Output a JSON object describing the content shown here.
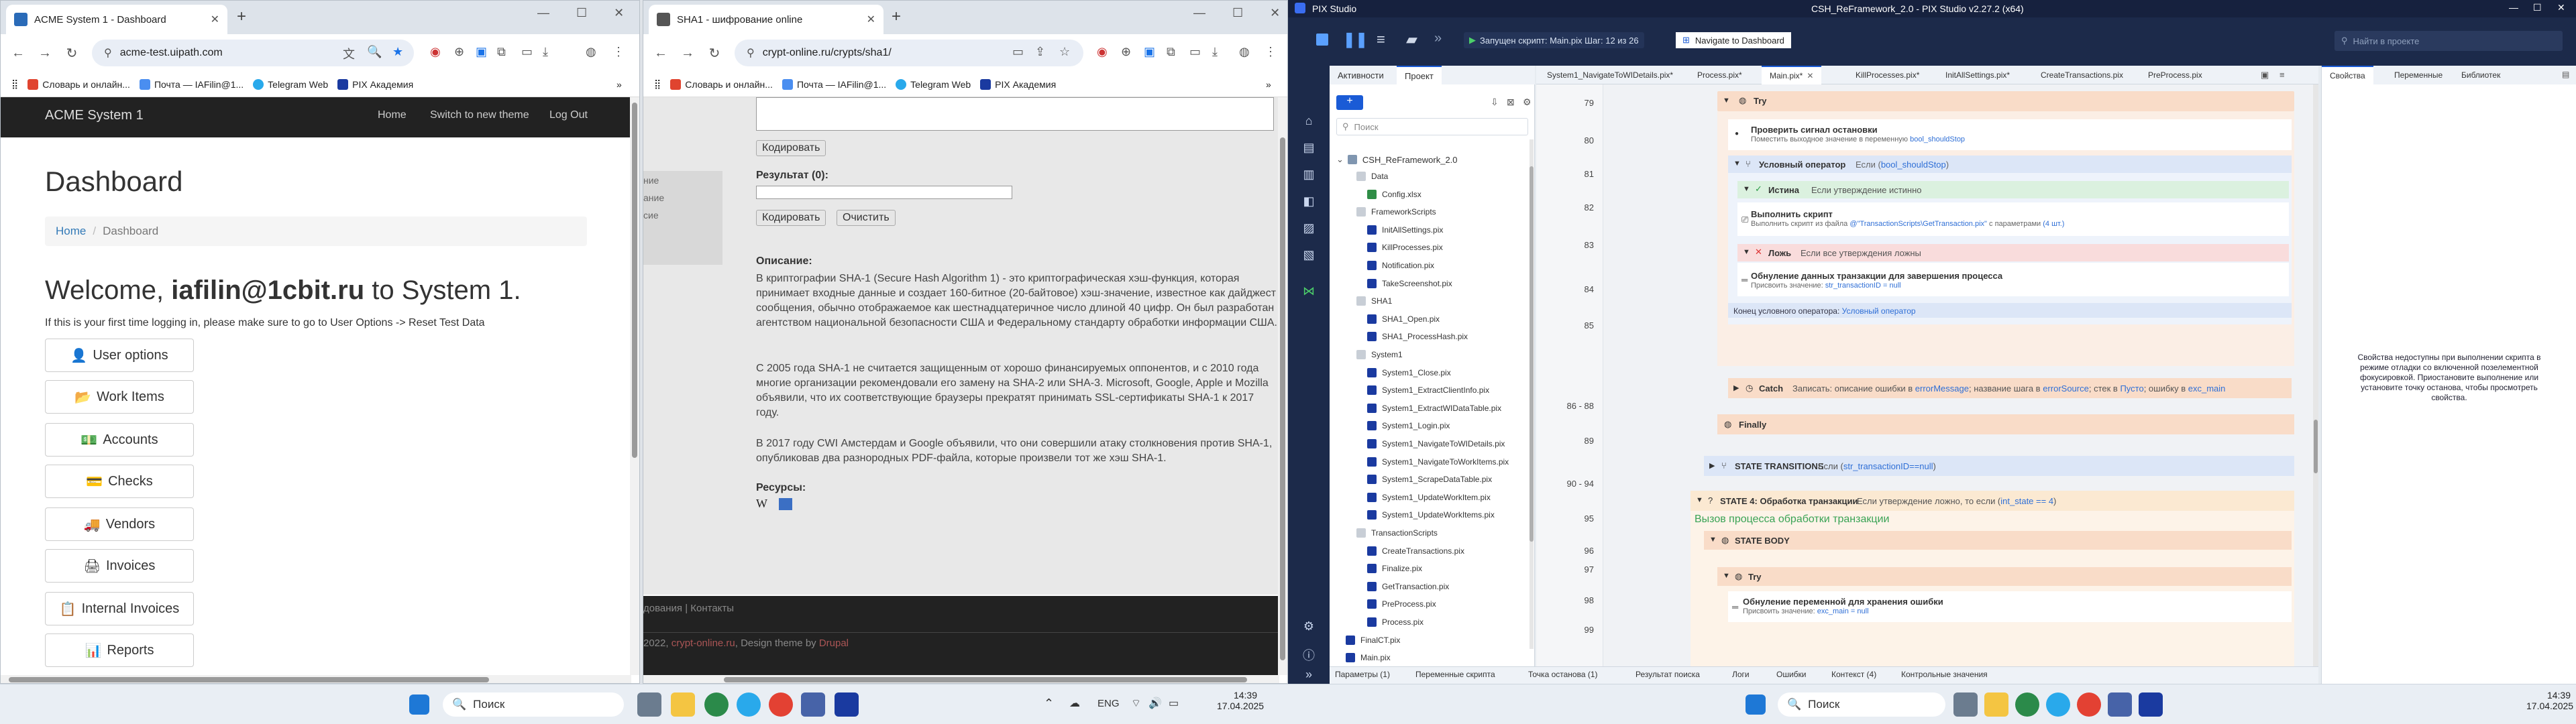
{
  "acme_browser": {
    "tab_title": "ACME System 1 - Dashboard",
    "url": "acme-test.uipath.com",
    "bookmarks": [
      "Словарь и онлайн...",
      "Почта — IAFilin@1...",
      "Telegram Web",
      "PIX Академия"
    ],
    "brand": "ACME System 1",
    "nav": [
      "Home",
      "Switch to new theme",
      "Log Out"
    ],
    "heading": "Dashboard",
    "breadcrumb": {
      "home": "Home",
      "sep": "/",
      "current": "Dashboard"
    },
    "welcome_pre": "Welcome, ",
    "welcome_user": "iafilin@1cbit.ru",
    "welcome_post": " to System 1.",
    "first_time_note": "If this is your first time logging in, please make sure to go to User Options -> Reset Test Data",
    "menu": [
      {
        "icon": "👤",
        "label": "User options"
      },
      {
        "icon": "📂",
        "label": "Work Items"
      },
      {
        "icon": "💵",
        "label": "Accounts"
      },
      {
        "icon": "💳",
        "label": "Checks"
      },
      {
        "icon": "🚚",
        "label": "Vendors"
      },
      {
        "icon": "🖨",
        "label": "Invoices"
      },
      {
        "icon": "📋",
        "label": "Internal Invoices"
      },
      {
        "icon": "📊",
        "label": "Reports"
      }
    ]
  },
  "crypt_browser": {
    "tab_title": "SHA1 - шифрование online",
    "url": "crypt-online.ru/crypts/sha1/",
    "bookmarks": [
      "Словарь и онлайн...",
      "Почта — IAFilin@1...",
      "Telegram Web",
      "PIX Академия"
    ],
    "encode_btn": "Кодировать",
    "result_label": "Результат (0):",
    "encode_btn2": "Кодировать",
    "clear_btn": "Очистить",
    "side_items": [
      "ние",
      "ание",
      "сие"
    ],
    "description_title": "Описание:",
    "p1": "В криптографии SHA-1 (Secure Hash Algorithm 1) - это криптографическая хэш-функция, которая принимает входные данные и создает 160-битное (20-байтовое) хэш-значение, известное как дайджест сообщения, обычно отображаемое как шестнадцатеричное число длиной 40 цифр. Он был разработан агентством национальной безопасности США и Федеральному стандарту обработки информации США.",
    "p2": "С 2005 года SHA-1 не считается защищенным от хорошо финансируемых оппонентов, и с 2010 года многие организации рекомендовали его замену на SHA-2 или SHA-3. Microsoft, Google, Apple и Mozilla объявили, что их соответствующие браузеры прекратят принимать SSL-сертификаты SHA-1 к 2017 году.",
    "p3": "В 2017 году CWI Амстердам и Google объявили, что они совершили атаку столкновения против SHA-1, опубликовав два разнородных PDF-файла, которые произвели тот же хэш SHA-1.",
    "resources": "Ресурсы:",
    "footer1_a": "дования",
    "footer1_sep": " | ",
    "footer1_b": "Контакты",
    "footer2_pre": "2022, ",
    "footer2_link": "crypt-online.ru",
    "footer2_mid": ", Design theme by ",
    "footer2_theme": "Drupal"
  },
  "pix": {
    "window_title": "CSH_ReFramework_2.0 - PIX Studio v2.27.2 (x64)",
    "app_name": "PIX Studio",
    "status": "Запущен скрипт: Main.pix  Шаг: 12 из 26",
    "nav_action": "Navigate to Dashboard",
    "search_project": "Найти в проекте",
    "search_tree": "Поиск",
    "panel_tabs": [
      "Активности",
      "Проект"
    ],
    "project_root": "CSH_ReFramework_2.0",
    "tree": [
      {
        "label": "Data",
        "lvl": 1,
        "type": "folder"
      },
      {
        "label": "Config.xlsx",
        "lvl": 2,
        "type": "xlsx"
      },
      {
        "label": "FrameworkScripts",
        "lvl": 1,
        "type": "folder"
      },
      {
        "label": "InitAllSettings.pix",
        "lvl": 2,
        "type": "pix"
      },
      {
        "label": "KillProcesses.pix",
        "lvl": 2,
        "type": "pix"
      },
      {
        "label": "Notification.pix",
        "lvl": 2,
        "type": "pix"
      },
      {
        "label": "TakeScreenshot.pix",
        "lvl": 2,
        "type": "pix"
      },
      {
        "label": "SHA1",
        "lvl": 1,
        "type": "folder"
      },
      {
        "label": "SHA1_Open.pix",
        "lvl": 2,
        "type": "pix"
      },
      {
        "label": "SHA1_ProcessHash.pix",
        "lvl": 2,
        "type": "pix"
      },
      {
        "label": "System1",
        "lvl": 1,
        "type": "folder"
      },
      {
        "label": "System1_Close.pix",
        "lvl": 2,
        "type": "pix"
      },
      {
        "label": "System1_ExtractClientInfo.pix",
        "lvl": 2,
        "type": "pix"
      },
      {
        "label": "System1_ExtractWIDataTable.pix",
        "lvl": 2,
        "type": "pix"
      },
      {
        "label": "System1_Login.pix",
        "lvl": 2,
        "type": "pix"
      },
      {
        "label": "System1_NavigateToWIDetails.pix",
        "lvl": 2,
        "type": "pix"
      },
      {
        "label": "System1_NavigateToWorkItems.pix",
        "lvl": 2,
        "type": "pix"
      },
      {
        "label": "System1_ScrapeDataTable.pix",
        "lvl": 2,
        "type": "pix"
      },
      {
        "label": "System1_UpdateWorkItem.pix",
        "lvl": 2,
        "type": "pix"
      },
      {
        "label": "System1_UpdateWorkItems.pix",
        "lvl": 2,
        "type": "pix"
      },
      {
        "label": "TransactionScripts",
        "lvl": 1,
        "type": "folder"
      },
      {
        "label": "CreateTransactions.pix",
        "lvl": 2,
        "type": "pix"
      },
      {
        "label": "Finalize.pix",
        "lvl": 2,
        "type": "pix"
      },
      {
        "label": "GetTransaction.pix",
        "lvl": 2,
        "type": "pix"
      },
      {
        "label": "PreProcess.pix",
        "lvl": 2,
        "type": "pix"
      },
      {
        "label": "Process.pix",
        "lvl": 2,
        "type": "pix"
      },
      {
        "label": "FinalCT.pix",
        "lvl": 0,
        "type": "pix"
      },
      {
        "label": "Main.pix",
        "lvl": 0,
        "type": "pix"
      }
    ],
    "editor_tabs": [
      "System1_NavigateToWIDetails.pix*",
      "Process.pix*",
      "Main.pix*",
      "KillProcesses.pix*",
      "InitAllSettings.pix*",
      "CreateTransactions.pix",
      "PreProcess.pix"
    ],
    "right_tabs": [
      "Свойства",
      "Переменные",
      "Библиотек"
    ],
    "right_note": "Свойства недоступны при выполнении скрипта в режиме отладки со включенной позелементной фокусировкой. Приостановите выполнение или установите точку останова, чтобы просмотреть свойства.",
    "lines": [
      "79",
      "80",
      "81",
      "82",
      "83",
      "84",
      "85",
      "",
      "86 - 88",
      "89",
      "90 - 94",
      "95",
      "96",
      "97",
      "98",
      "99"
    ],
    "code": {
      "try": "Try",
      "check_title": "Проверить сигнал остановки",
      "check_sub": "Поместить выходное значение в переменную",
      "check_var": "bool_shouldStop",
      "if_title": "Условный оператор",
      "if_cond_pre": "Если (",
      "if_cond_var": "bool_shouldStop",
      "if_cond_post": ")",
      "true_title": "Истина",
      "true_sub": "Если утверждение истинно",
      "run_title": "Выполнить скрипт",
      "run_sub_pre": "Выполнить скрипт из файла",
      "run_sub_file": "@\"TransactionScripts\\GetTransaction.pix\"",
      "run_sub_mid": "с параметрами",
      "run_sub_params": "(4 шт.)",
      "false_title": "Ложь",
      "false_sub": "Если все утверждения ложны",
      "reset_title": "Обнуление данных транзакции для завершения процесса",
      "reset_sub": "Присвоить значение:",
      "reset_val": "str_transactionID = null",
      "end_if": "Конец условного оператора:",
      "end_if_name": "Условный оператор",
      "catch_title": "Catch",
      "catch_sub_1": "Записать: описание ошибки в",
      "catch_v1": "errorMessage",
      "catch_sub_2": "; название шага в",
      "catch_v2": "errorSource",
      "catch_sub_3": "; стек в",
      "catch_v3": "Пусто",
      "catch_sub_4": "; ошибку в",
      "catch_v4": "exc_main",
      "finally": "Finally",
      "trans_title": "STATE TRANSITIONS",
      "trans_cond_pre": "Если (",
      "trans_cond_var": "str_transactionID==null",
      "trans_cond_post": ")",
      "state4_title": "STATE 4: Обработка транзакции",
      "state4_cond_pre": "Если утверждение ложно, то если (",
      "state4_cond_var": "int_state == 4",
      "state4_cond_post": ")",
      "comment": "Вызов процесса обработки транзакции",
      "body_title": "STATE BODY",
      "try2": "Try",
      "reset2_title": "Обнуление переменной для хранения ошибки",
      "reset2_sub": "Присвоить значение:",
      "reset2_val": "exc_main = null"
    },
    "bottom_tabs": [
      "Параметры (1)",
      "Переменные скрипта",
      "Точка останова (1)",
      "Результат поиска",
      "Логи",
      "Ошибки",
      "Контекст (4)",
      "Контрольные значения"
    ]
  },
  "taskbar_left": {
    "search": "Поиск",
    "lang": "ENG",
    "time": "14:39",
    "date": "17.04.2025"
  },
  "taskbar_right": {
    "search": "Поиск",
    "time": "14:39",
    "date": "17.04.2025"
  }
}
